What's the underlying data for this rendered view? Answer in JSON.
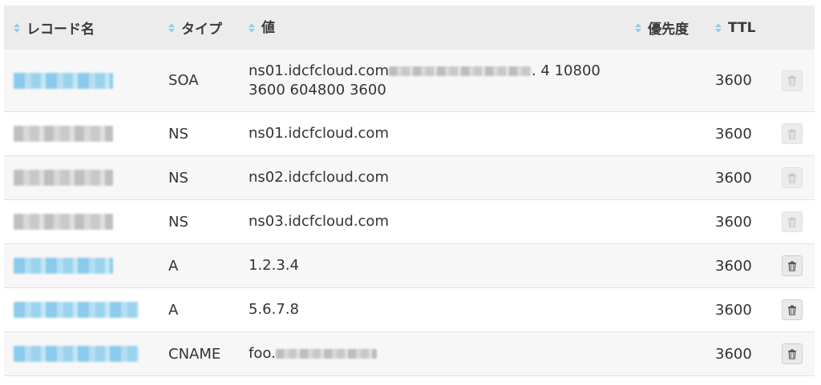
{
  "columns": {
    "name": "レコード名",
    "type": "タイプ",
    "value": "値",
    "priority": "優先度",
    "ttl": "TTL"
  },
  "records": [
    {
      "type": "SOA",
      "value_prefix": "ns01.idcfcloud.com",
      "value_suffix": ". 4 10800",
      "value_line2": "3600 604800 3600",
      "ttl": "3600",
      "name_style": "link",
      "delete_enabled": false
    },
    {
      "type": "NS",
      "value": "ns01.idcfcloud.com",
      "ttl": "3600",
      "name_style": "plain",
      "delete_enabled": false
    },
    {
      "type": "NS",
      "value": "ns02.idcfcloud.com",
      "ttl": "3600",
      "name_style": "plain",
      "delete_enabled": false
    },
    {
      "type": "NS",
      "value": "ns03.idcfcloud.com",
      "ttl": "3600",
      "name_style": "plain",
      "delete_enabled": false
    },
    {
      "type": "A",
      "value": "1.2.3.4",
      "ttl": "3600",
      "name_style": "link",
      "delete_enabled": true
    },
    {
      "type": "A",
      "value": "5.6.7.8",
      "ttl": "3600",
      "name_style": "link",
      "delete_enabled": true
    },
    {
      "type": "CNAME",
      "value_prefix": "foo.",
      "ttl": "3600",
      "name_style": "link",
      "delete_enabled": true
    }
  ],
  "icons": {
    "sort": "sort-icon",
    "delete": "trash-icon"
  },
  "colors": {
    "header_bg": "#ececec",
    "link_blue": "#7fc6ea",
    "sort_icon": "#8fd0ea"
  }
}
